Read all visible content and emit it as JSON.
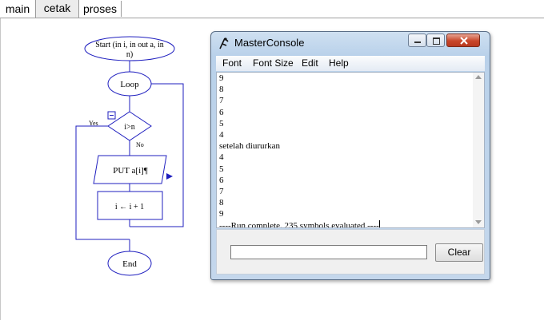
{
  "tabs": [
    {
      "label": "main"
    },
    {
      "label": "cetak"
    },
    {
      "label": "proses"
    }
  ],
  "flowchart": {
    "start_line1": "Start (in i, in out a, in",
    "start_line2": "n)",
    "loop": "Loop",
    "condition": "i>n",
    "yes": "Yes",
    "no": "No",
    "put": "PUT a[i]¶",
    "assign": "i ← i + 1",
    "end": "End"
  },
  "console": {
    "title": "MasterConsole",
    "menu": [
      "Font",
      "Font Size",
      "Edit",
      "Help"
    ],
    "output": [
      "9",
      "8",
      "7",
      "6",
      "5",
      "4",
      "setelah diururkan",
      "4",
      "5",
      "6",
      "7",
      "8",
      "9",
      "----Run complete.  235 symbols evaluated.----"
    ],
    "input_value": "",
    "clear_label": "Clear"
  },
  "colors": {
    "flow_stroke": "#1f1fbf",
    "titlebar": "#b9d1ea",
    "close_button": "#c8462a"
  }
}
